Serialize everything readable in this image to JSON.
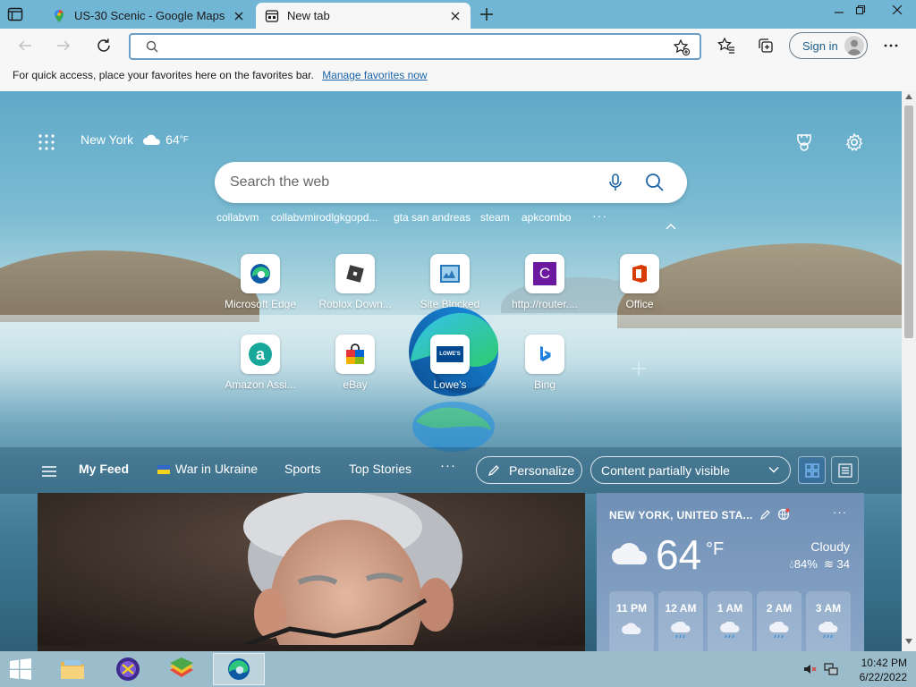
{
  "tabs": [
    {
      "title": "US-30 Scenic - Google Maps",
      "active": false
    },
    {
      "title": "New tab",
      "active": true
    }
  ],
  "toolbar": {
    "address_value": "",
    "signin_label": "Sign in"
  },
  "favorites_bar": {
    "message": "For quick access, place your favorites here on the favorites bar.",
    "link": "Manage favorites now"
  },
  "ntp": {
    "weather_city": "New York",
    "weather_temp": "64",
    "weather_unit": "°F",
    "search_placeholder": "Search the web",
    "trending": [
      "collabvm",
      "collabvmirodlgkgopd...",
      "gta san andreas",
      "steam",
      "apkcombo"
    ],
    "trending_more": "···",
    "tiles": [
      {
        "label": "Microsoft Edge",
        "icon": "edge-icon"
      },
      {
        "label": "Roblox Down...",
        "icon": "roblox-icon"
      },
      {
        "label": "Site Blocked",
        "icon": "site-blocked-icon"
      },
      {
        "label": "http://router....",
        "icon": "c-letter-icon"
      },
      {
        "label": "Office",
        "icon": "office-icon"
      },
      {
        "label": "Amazon Assi...",
        "icon": "amazon-assistant-icon"
      },
      {
        "label": "eBay",
        "icon": "ebay-icon"
      },
      {
        "label": "Lowe's",
        "icon": "lowes-icon"
      },
      {
        "label": "Bing",
        "icon": "bing-icon"
      }
    ],
    "tile_letters": {
      "c": "C",
      "a": "a",
      "lowes": "LOWE'S"
    }
  },
  "feed": {
    "tabs": [
      "My Feed",
      "War in Ukraine",
      "Sports",
      "Top Stories"
    ],
    "more": "···",
    "personalize_label": "Personalize",
    "visibility_label": "Content partially visible"
  },
  "weather_card": {
    "location": "NEW YORK, UNITED STA...",
    "more": "···",
    "temp": "64",
    "unit": "°F",
    "condition": "Cloudy",
    "humidity": "84%",
    "wind": "34",
    "hours": [
      "11 PM",
      "12 AM",
      "1 AM",
      "2 AM",
      "3 AM"
    ]
  },
  "taskbar": {
    "time": "10:42 PM",
    "date": "6/22/2022"
  },
  "colors": {
    "tabstrip": "#72b6d6",
    "accent_link": "#1a64a8",
    "edge_blue": "#0c59a4",
    "edge_green": "#2ec67a"
  }
}
